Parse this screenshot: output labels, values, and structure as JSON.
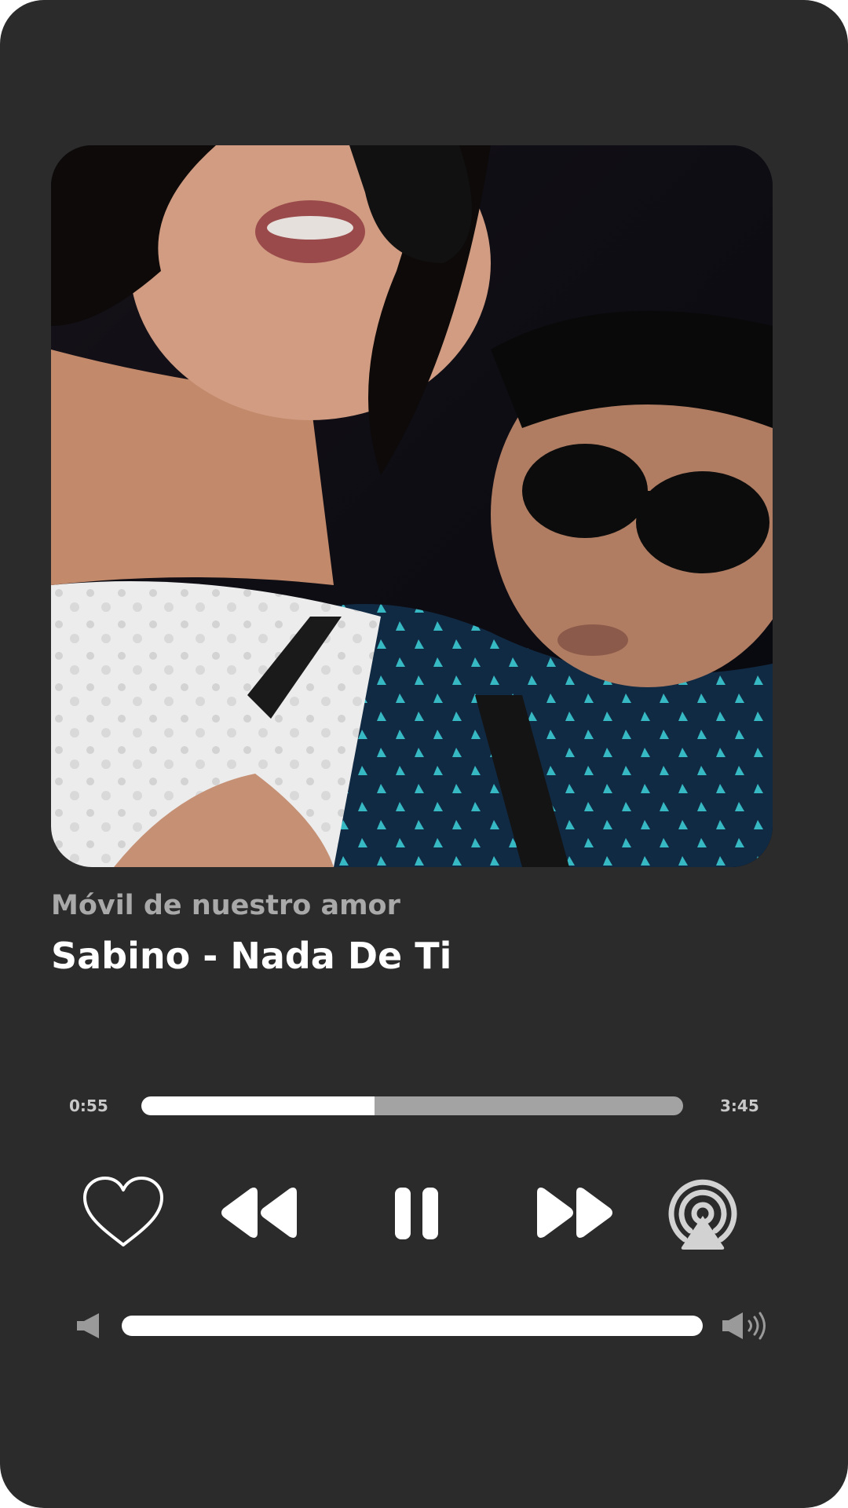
{
  "track": {
    "subtitle": "Móvil de nuestro amor",
    "title": "Sabino - Nada De Ti"
  },
  "playback": {
    "elapsed": "0:55",
    "total": "3:45",
    "progress_fraction": 0.43,
    "state": "playing"
  },
  "volume": {
    "level_fraction": 1.0
  },
  "controls": {
    "like_icon": "heart-outline-icon",
    "previous_icon": "rewind-icon",
    "playpause_icon": "pause-icon",
    "next_icon": "fast-forward-icon",
    "cast_icon": "airplay-broadcast-icon"
  },
  "colors": {
    "background": "#2b2b2b",
    "text_primary": "#ffffff",
    "text_secondary": "#a9a9a9",
    "track_fill": "#ffffff",
    "track_rest": "#a3a3a3"
  }
}
